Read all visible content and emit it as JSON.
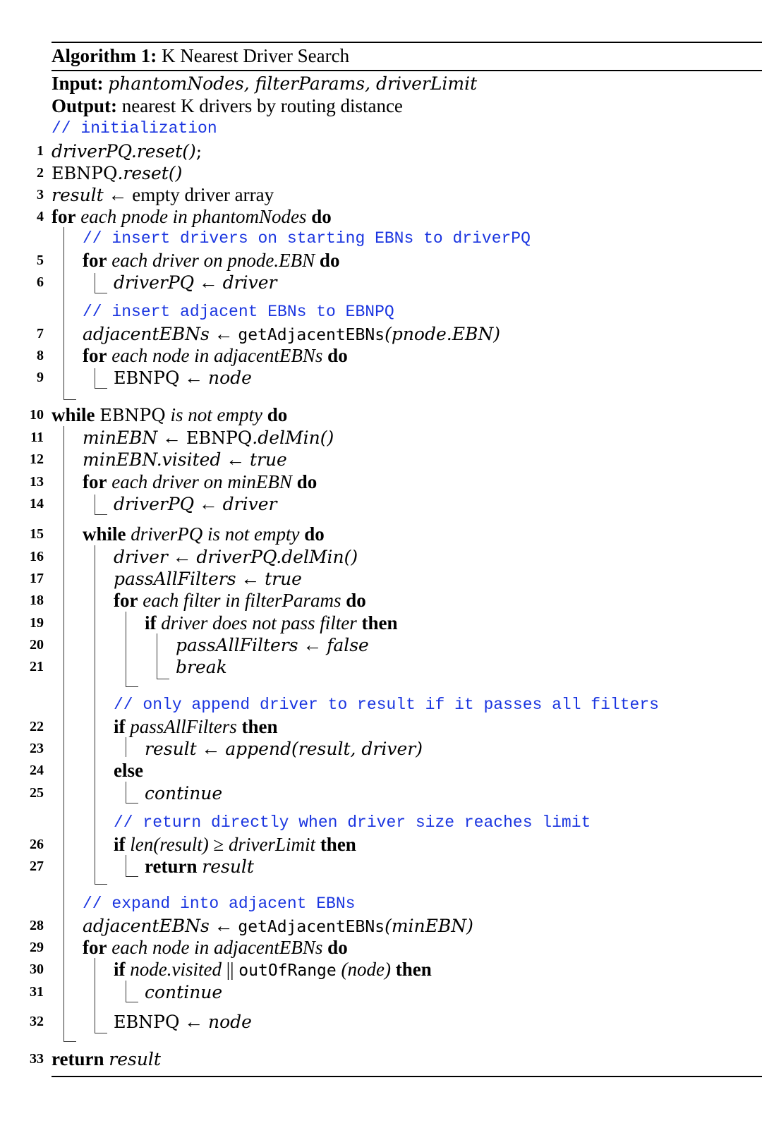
{
  "algorithm": {
    "label": "Algorithm 1:",
    "title": "K Nearest Driver Search",
    "input_label": "Input:",
    "input_value": "phantomNodes, filterParams, driverLimit",
    "output_label": "Output:",
    "output_value": "nearest K drivers by routing distance"
  },
  "comments": {
    "c0": "// initialization",
    "c1": "// insert drivers on starting EBNs to driverPQ",
    "c2": "// insert adjacent EBNs to EBNPQ",
    "c3": "// only append driver to result if it passes all filters",
    "c4": "// return directly when driver size reaches limit",
    "c5": "// expand into adjacent EBNs"
  },
  "lines": [
    {
      "n": "1",
      "text": "driverPQ.reset();"
    },
    {
      "n": "2",
      "text": "EBNPQ.reset()"
    },
    {
      "n": "3",
      "text": "result ← empty driver array"
    },
    {
      "n": "4",
      "text": "for each pnode in phantomNodes do"
    },
    {
      "n": "5",
      "text": "for each driver on pnode.EBN do"
    },
    {
      "n": "6",
      "text": "driverPQ ← driver"
    },
    {
      "n": "7",
      "text": "adjacentEBNs ← getAdjacentEBNs(pnode.EBN)"
    },
    {
      "n": "8",
      "text": "for each node in adjacentEBNs do"
    },
    {
      "n": "9",
      "text": "EBNPQ ← node"
    },
    {
      "n": "10",
      "text": "while EBNPQ is not empty do"
    },
    {
      "n": "11",
      "text": "minEBN ← EBNPQ.delMin()"
    },
    {
      "n": "12",
      "text": "minEBN.visited ← true"
    },
    {
      "n": "13",
      "text": "for each driver on minEBN do"
    },
    {
      "n": "14",
      "text": "driverPQ ← driver"
    },
    {
      "n": "15",
      "text": "while driverPQ is not empty do"
    },
    {
      "n": "16",
      "text": "driver ← driverPQ.delMin()"
    },
    {
      "n": "17",
      "text": "passAllFilters ← true"
    },
    {
      "n": "18",
      "text": "for each filter in filterParams do"
    },
    {
      "n": "19",
      "text": "if driver does not pass filter then"
    },
    {
      "n": "20",
      "text": "passAllFilters ← false"
    },
    {
      "n": "21",
      "text": "break"
    },
    {
      "n": "22",
      "text": "if passAllFilters then"
    },
    {
      "n": "23",
      "text": "result ← append(result, driver)"
    },
    {
      "n": "24",
      "text": "else"
    },
    {
      "n": "25",
      "text": "continue"
    },
    {
      "n": "26",
      "text": "if len(result) ≥ driverLimit then"
    },
    {
      "n": "27",
      "text": "return result"
    },
    {
      "n": "28",
      "text": "adjacentEBNs ← getAdjacentEBNs(minEBN)"
    },
    {
      "n": "29",
      "text": "for each node in adjacentEBNs do"
    },
    {
      "n": "30",
      "text": "if node.visited || outOfRange (node) then"
    },
    {
      "n": "31",
      "text": "continue"
    },
    {
      "n": "32",
      "text": "EBNPQ ← node"
    },
    {
      "n": "33",
      "text": "return result"
    }
  ],
  "tokens": {
    "for": "for",
    "do": "do",
    "while": "while",
    "if": "if",
    "then": "then",
    "else": "else",
    "return": "return",
    "arrow": "←",
    "ge": "≥",
    "oror": "||",
    "driverPQ": "driverPQ",
    "reset": ".reset()",
    "semi": ";",
    "EBN": "EBN",
    "PQ": "PQ",
    "result": "result",
    "empty_driver_array": "empty driver array",
    "each_pnode": "each pnode in phantomNodes",
    "each_driver_pnode": "each driver on pnode.EBN",
    "driver": "driver",
    "adjacentEBNs": "adjacentEBNs",
    "getAdjacentEBNs": "getAdjacentEBNs",
    "pnode_EBN": "(pnode.EBN)",
    "each_node_adj": "each node in adjacentEBNs",
    "node": "node",
    "is_not_empty": "is not empty",
    "minEBN": "minEBN",
    "delMin": ".delMin()",
    "visited": ".visited",
    "true": "true",
    "each_driver_minEBN": "each driver on minEBN",
    "driverPQ_is_not_empty": "driverPQ is not empty",
    "passAllFilters": "passAllFilters",
    "each_filter": "each filter in filterParams",
    "driver_not_pass": "driver does not pass filter",
    "false": "false",
    "break": "break",
    "passAllFilters_it": "passAllFilters",
    "append": "append(result, driver)",
    "continue": "continue",
    "len_result": "len(result)",
    "driverLimit": "driverLimit",
    "minEBN_paren": "(minEBN)",
    "node_visited": "node.visited",
    "outOfRange": "outOfRange",
    "node_paren": "(node)"
  }
}
